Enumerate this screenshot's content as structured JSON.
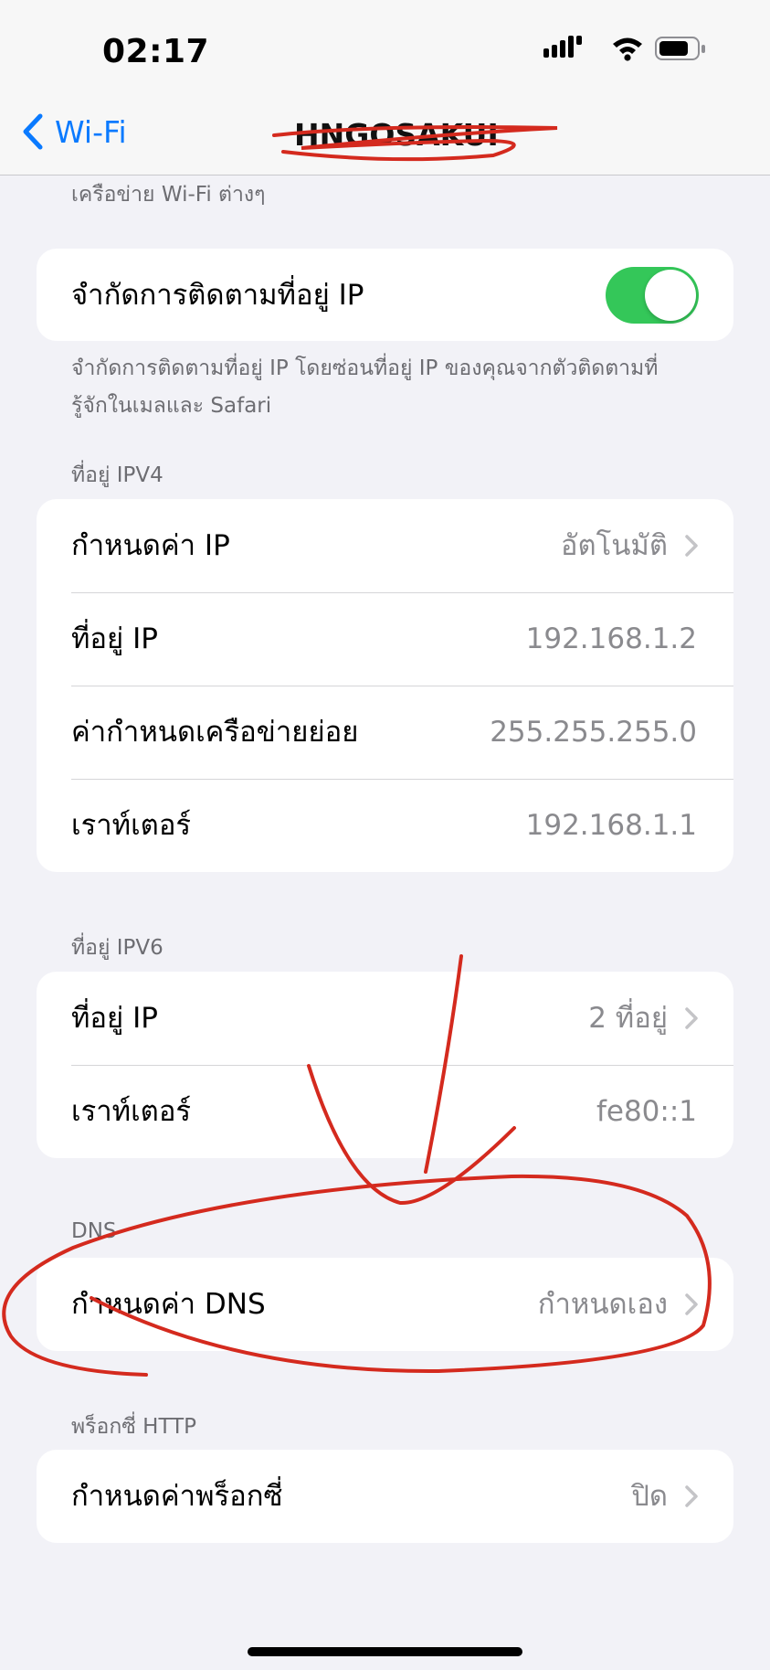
{
  "status": {
    "time": "02:17"
  },
  "nav": {
    "back_label": "Wi-Fi",
    "title": "HNGOSAKUI"
  },
  "top_caption": "เครือข่าย Wi-Fi ต่างๆ",
  "limit_ip": {
    "label": "จำกัดการติดตามที่อยู่ IP",
    "enabled": true,
    "footer_line1": "จำกัดการติดตามที่อยู่ IP โดยซ่อนที่อยู่ IP ของคุณจากตัวติดตามที่",
    "footer_line2": "รู้จักในเมลและ Safari"
  },
  "ipv4": {
    "header": "ที่อยู่ IPV4",
    "rows": [
      {
        "label": "กำหนดค่า IP",
        "value": "อัตโนมัติ"
      },
      {
        "label": "ที่อยู่ IP",
        "value": "192.168.1.2"
      },
      {
        "label": "ค่ากำหนดเครือข่ายย่อย",
        "value": "255.255.255.0"
      },
      {
        "label": "เราท์เตอร์",
        "value": "192.168.1.1"
      }
    ]
  },
  "ipv6": {
    "header": "ที่อยู่ IPV6",
    "rows": [
      {
        "label": "ที่อยู่ IP",
        "value": "2 ที่อยู่"
      },
      {
        "label": "เราท์เตอร์",
        "value": "fe80::1"
      }
    ]
  },
  "dns": {
    "header": "DNS",
    "rows": [
      {
        "label": "กำหนดค่า DNS",
        "value": "กำหนดเอง"
      }
    ]
  },
  "proxy": {
    "header": "พร็อกซี่ HTTP",
    "rows": [
      {
        "label": "กำหนดค่าพร็อกซี่",
        "value": "ปิด"
      }
    ]
  },
  "colors": {
    "accent": "#0a7aff",
    "toggle_on": "#34c759",
    "annotation": "#d42a1e",
    "background": "#f2f2f7"
  },
  "icons": [
    "cellular-signal-icon",
    "wifi-icon",
    "battery-icon",
    "chevron-left-icon",
    "chevron-right-icon"
  ]
}
